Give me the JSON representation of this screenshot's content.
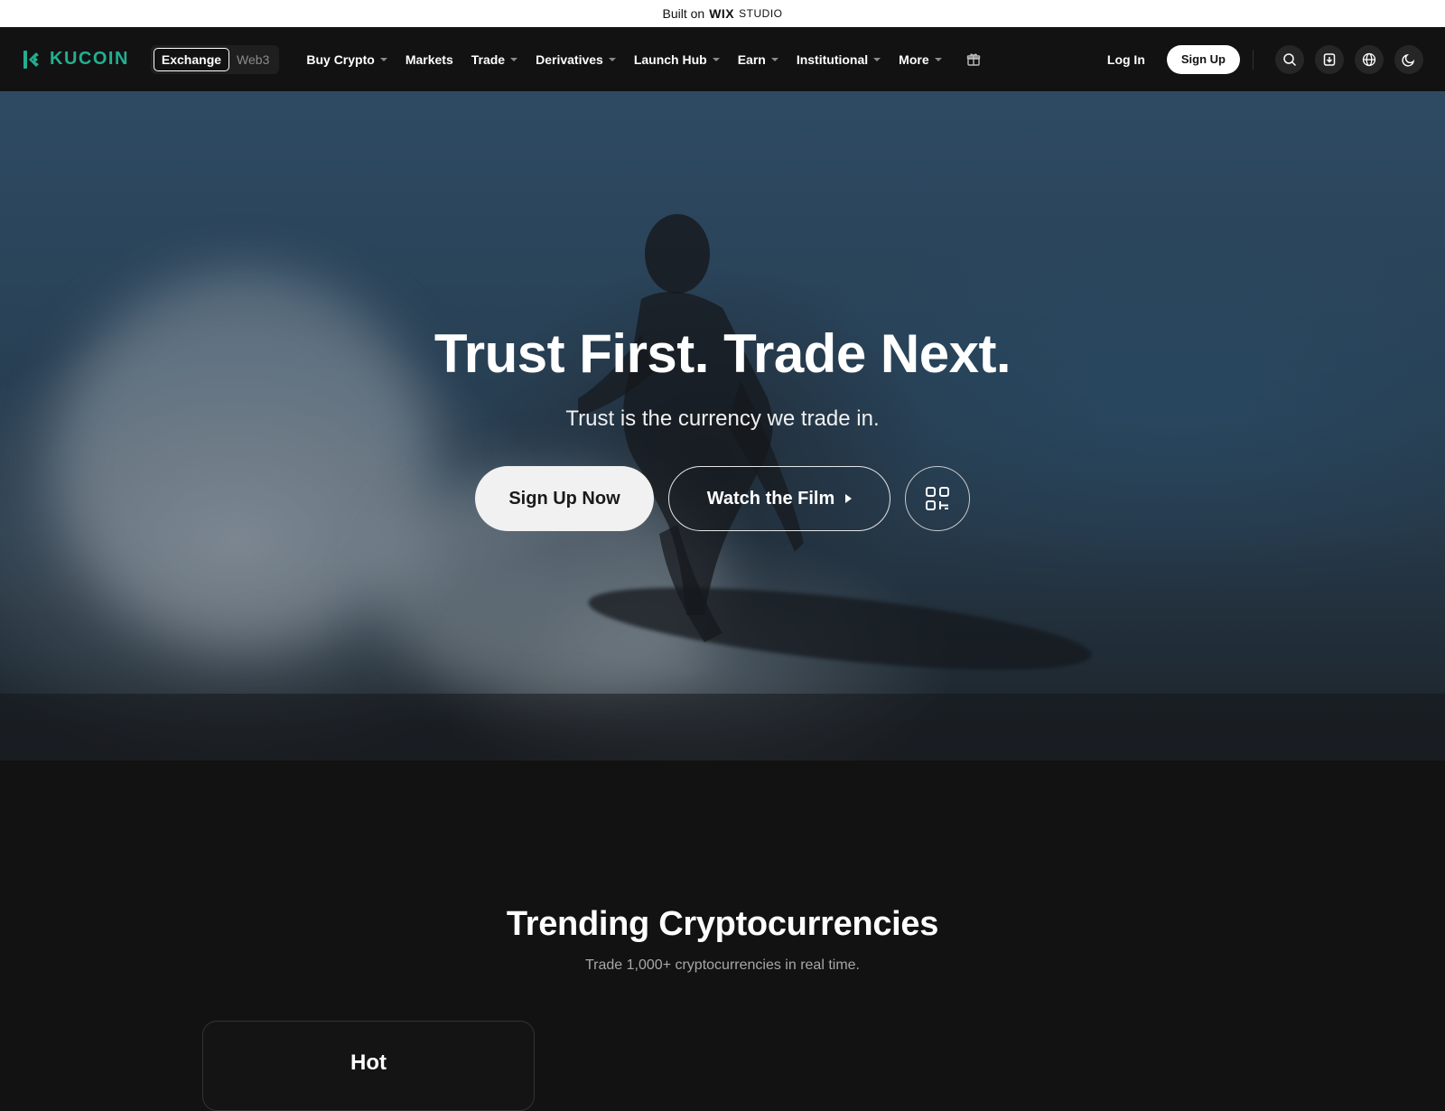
{
  "wix_banner": {
    "prefix": "Built on",
    "brand": "WIX",
    "brand_suffix": "STUDIO"
  },
  "nav": {
    "logo_text": "KUCOIN",
    "modes": [
      "Exchange",
      "Web3"
    ],
    "active_mode": "Exchange",
    "menu": [
      {
        "label": "Buy Crypto",
        "dropdown": true
      },
      {
        "label": "Markets",
        "dropdown": false
      },
      {
        "label": "Trade",
        "dropdown": true
      },
      {
        "label": "Derivatives",
        "dropdown": true
      },
      {
        "label": "Launch Hub",
        "dropdown": true
      },
      {
        "label": "Earn",
        "dropdown": true
      },
      {
        "label": "Institutional",
        "dropdown": true
      },
      {
        "label": "More",
        "dropdown": true
      }
    ],
    "login_label": "Log In",
    "signup_label": "Sign Up",
    "icons": [
      "gift-icon",
      "search-icon",
      "download-icon",
      "globe-icon",
      "moon-icon"
    ]
  },
  "hero": {
    "title": "Trust First. Trade Next.",
    "subtitle": "Trust is the currency we trade in.",
    "cta_primary": "Sign Up Now",
    "cta_secondary": "Watch the Film",
    "qr_icon": "qr-code-icon"
  },
  "trending": {
    "title": "Trending Cryptocurrencies",
    "subtitle": "Trade 1,000+ cryptocurrencies in real time.",
    "card_title": "Hot"
  },
  "colors": {
    "brand": "#23af91",
    "background": "#121212",
    "text": "#ffffff"
  }
}
